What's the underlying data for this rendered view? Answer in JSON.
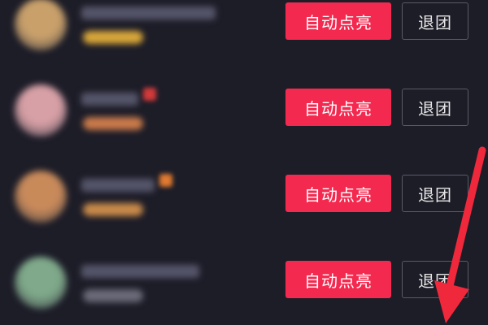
{
  "groups": [
    {
      "light_label": "自动点亮",
      "quit_label": "退团",
      "avatar_color": "#c9a06a",
      "name_color": "#55556a",
      "name_width": 165,
      "tag_color": "#d9a73a",
      "badge_color": ""
    },
    {
      "light_label": "自动点亮",
      "quit_label": "退团",
      "avatar_color": "#d7a0a6",
      "name_color": "#55556a",
      "name_width": 70,
      "tag_color": "#c97a4a",
      "badge_color": "#d13a3a"
    },
    {
      "light_label": "自动点亮",
      "quit_label": "退团",
      "avatar_color": "#c98a5a",
      "name_color": "#55556a",
      "name_width": 90,
      "tag_color": "#c98a4a",
      "badge_color": "#e07a30"
    },
    {
      "light_label": "自动点亮",
      "quit_label": "退团",
      "avatar_color": "#7fa98a",
      "name_color": "#55556a",
      "name_width": 145,
      "tag_color": "#6a6a78",
      "badge_color": ""
    }
  ],
  "colors": {
    "background": "#1d1d28",
    "light_button": "#f4294f",
    "annotation_arrow": "#f0283c"
  },
  "icons": {
    "annotation": "arrow-down-icon"
  }
}
